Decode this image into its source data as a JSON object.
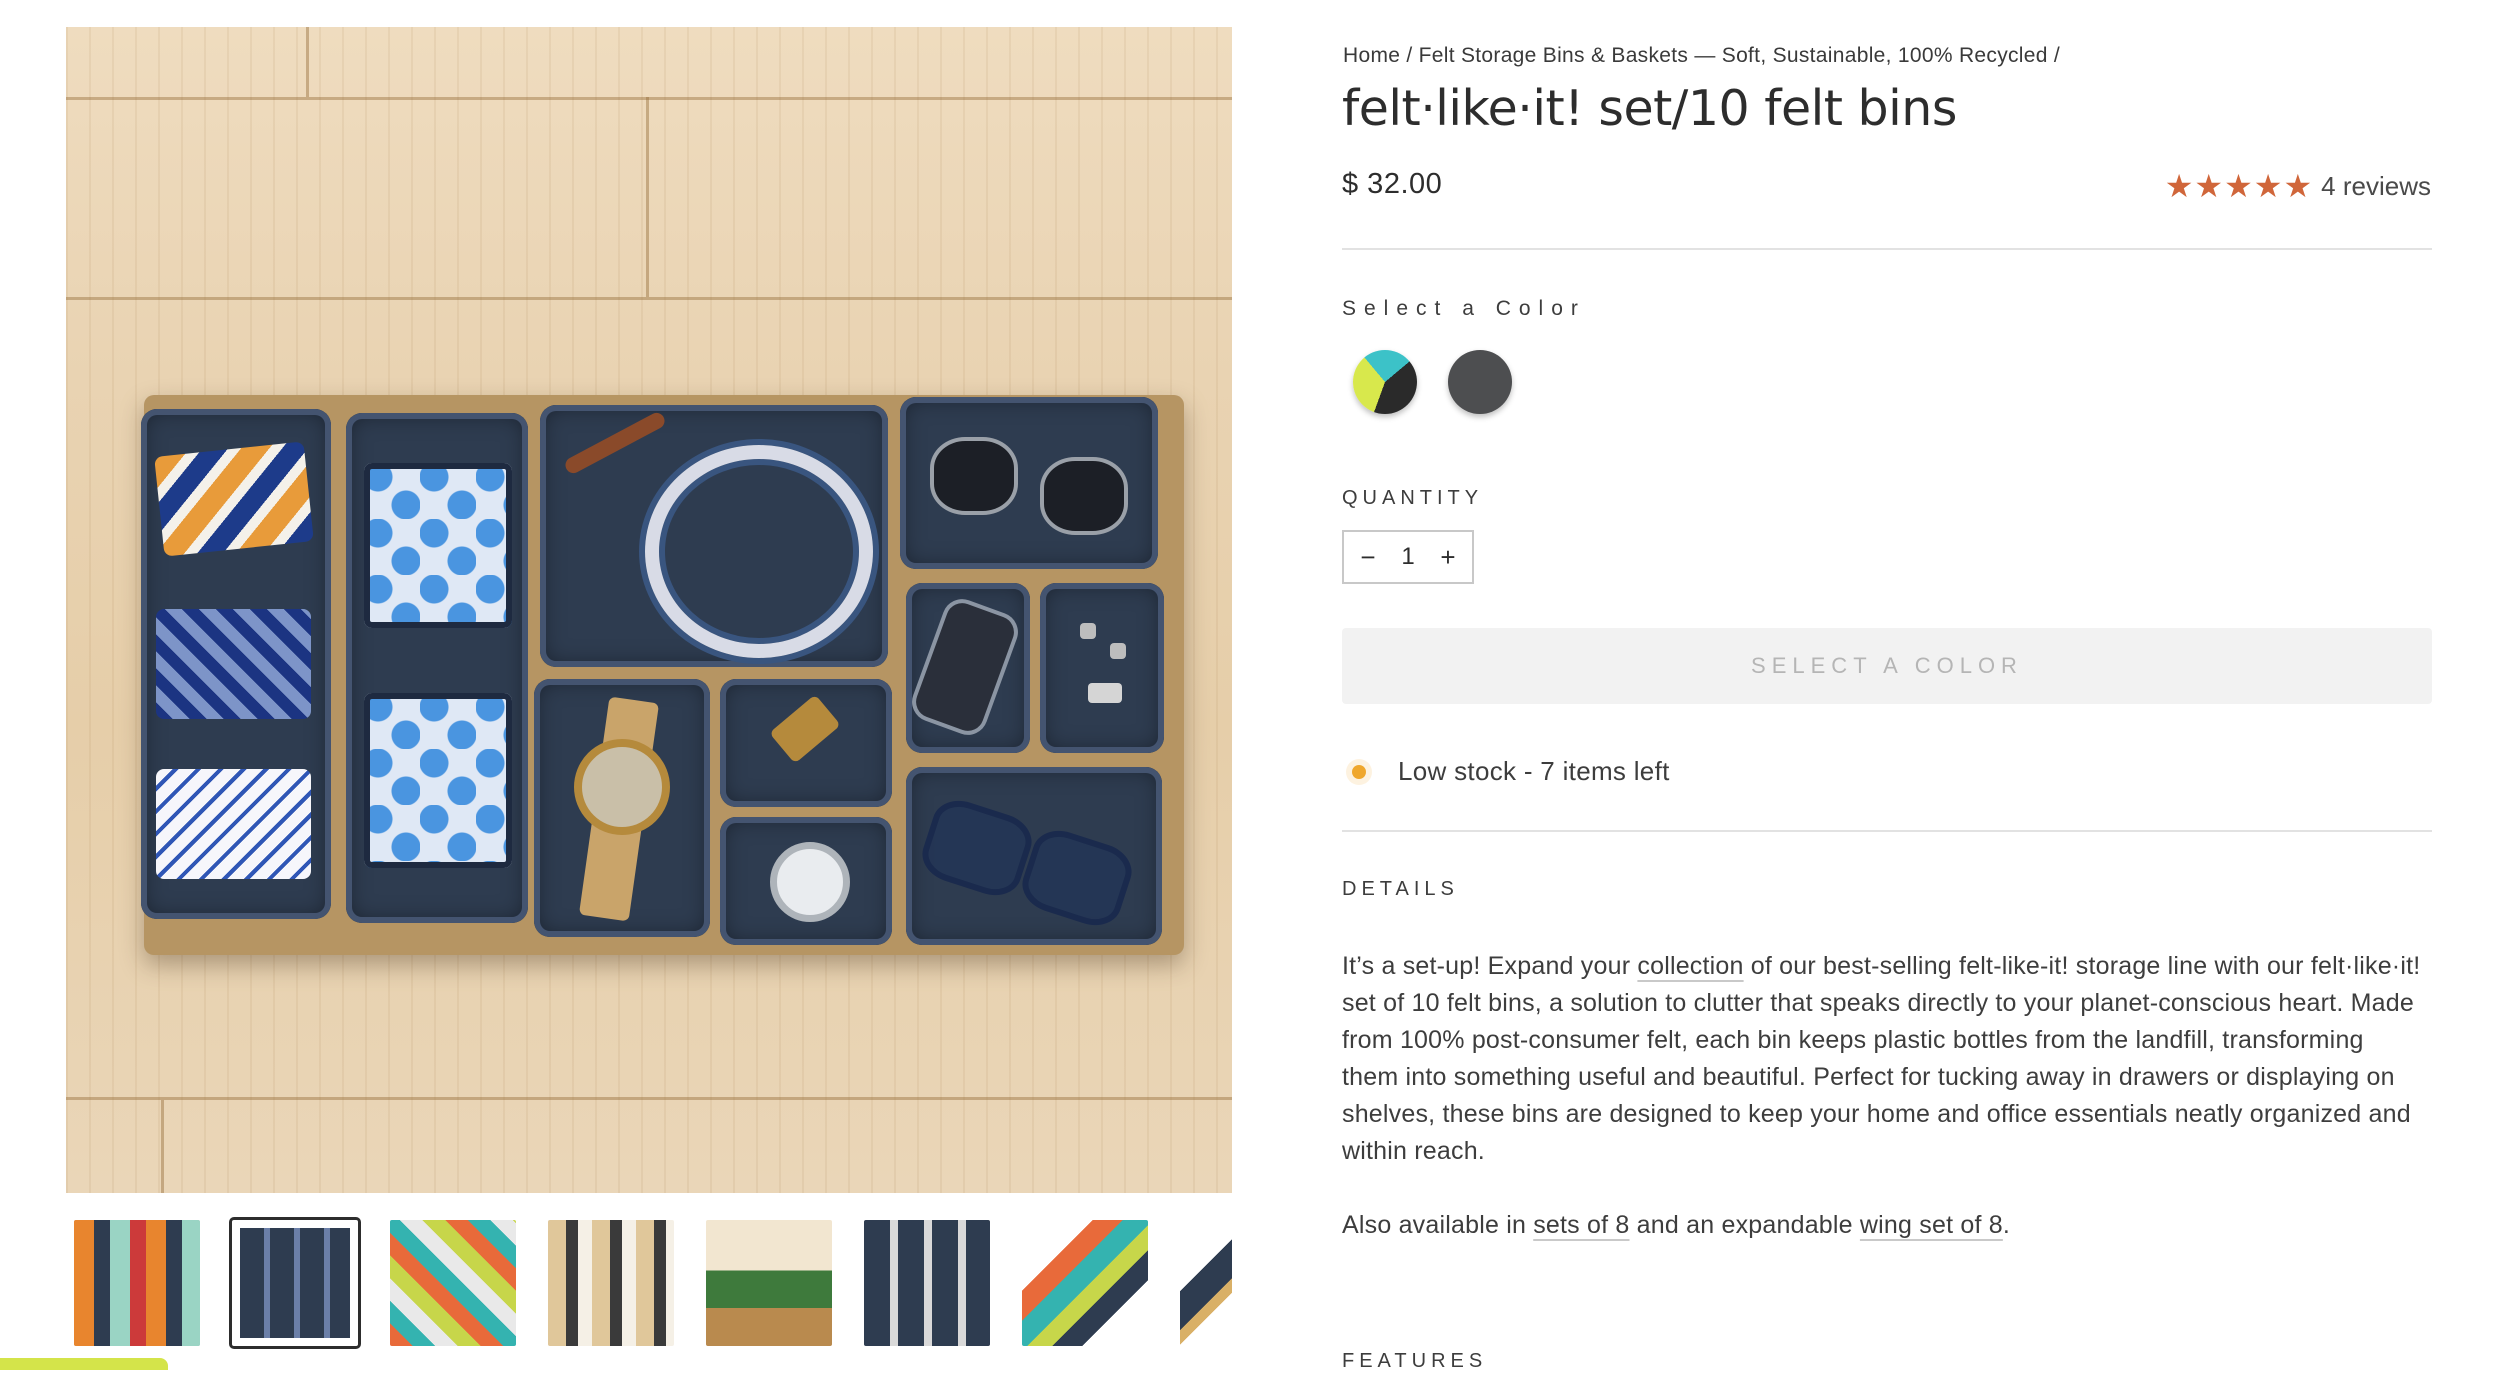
{
  "breadcrumb": {
    "home": "Home",
    "sep1": "/",
    "category": "Felt Storage Bins & Baskets — Soft, Sustainable, 100% Recycled",
    "sep2": "/"
  },
  "product": {
    "title": "felt·like·it! set/10 felt bins",
    "price": "$ 32.00",
    "rating_stars": 5,
    "reviews": "4 reviews"
  },
  "colors": {
    "accent_star": "#d0663a",
    "stock_dot": "#efa72d",
    "swatch_gray": "#4d4e50"
  },
  "color_select": {
    "label": "Select a Color",
    "swatches": [
      "multicolor-swatch",
      "charcoal-gray-swatch"
    ]
  },
  "quantity": {
    "label": "QUANTITY",
    "value": "1",
    "minus": "−",
    "plus": "+"
  },
  "cta": {
    "label": "SELECT A COLOR"
  },
  "stock": {
    "text": "Low stock - 7 items left"
  },
  "details": {
    "heading": "DETAILS",
    "p1_before": "It’s a set-up! Expand your ",
    "p1_link": "collection",
    "p1_after": " of our best-selling felt-like-it! storage line with our felt·like·it! set of 10 felt bins, a solution to clutter that speaks directly to your planet-conscious heart. Made from 100% post-consumer felt, each bin keeps plastic bottles from the landfill, transforming them into something useful and beautiful. Perfect for tucking away in drawers or displaying on shelves, these bins are designed to keep your home and office essentials neatly organized and within reach.",
    "p2_before": "Also available in ",
    "p2_link1": "sets of 8",
    "p2_mid": " and an expandable ",
    "p2_link2": "wing set of 8",
    "p2_after": "."
  },
  "features": {
    "heading": "FEATURES"
  },
  "gallery": {
    "thumbnail_count": 8,
    "active_thumbnail": 2
  }
}
